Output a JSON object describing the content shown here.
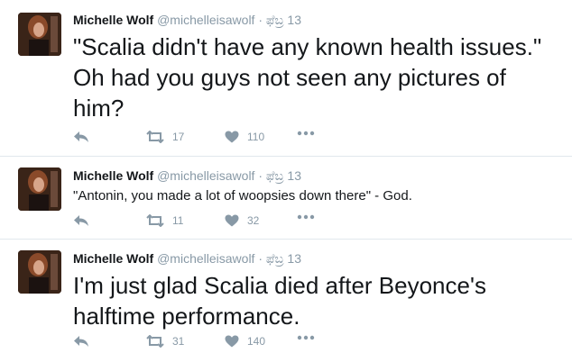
{
  "tweets": [
    {
      "name": "Michelle Wolf",
      "handle": "@michelleisawolf",
      "separator": "·",
      "date": "ಫೆಬ್ರ 13",
      "text": "\"Scalia didn't have any known health issues.\" Oh had you guys not seen any pictures of him?",
      "retweets": "17",
      "likes": "110"
    },
    {
      "name": "Michelle Wolf",
      "handle": "@michelleisawolf",
      "separator": "·",
      "date": "ಫೆಬ್ರ 13",
      "text": "\"Antonin, you made a lot of woopsies down there\" - God.",
      "retweets": "11",
      "likes": "32"
    },
    {
      "name": "Michelle Wolf",
      "handle": "@michelleisawolf",
      "separator": "·",
      "date": "ಫೆಬ್ರ 13",
      "text": "I'm just glad Scalia died after Beyonce's halftime performance.",
      "retweets": "31",
      "likes": "140"
    }
  ],
  "icons": {
    "reply": "reply-icon",
    "retweet": "retweet-icon",
    "like": "heart-icon",
    "more": "more-dots-icon",
    "avatar": "avatar"
  },
  "colors": {
    "text": "#14171a",
    "muted": "#8899a6",
    "divider": "#e1e8ed"
  }
}
